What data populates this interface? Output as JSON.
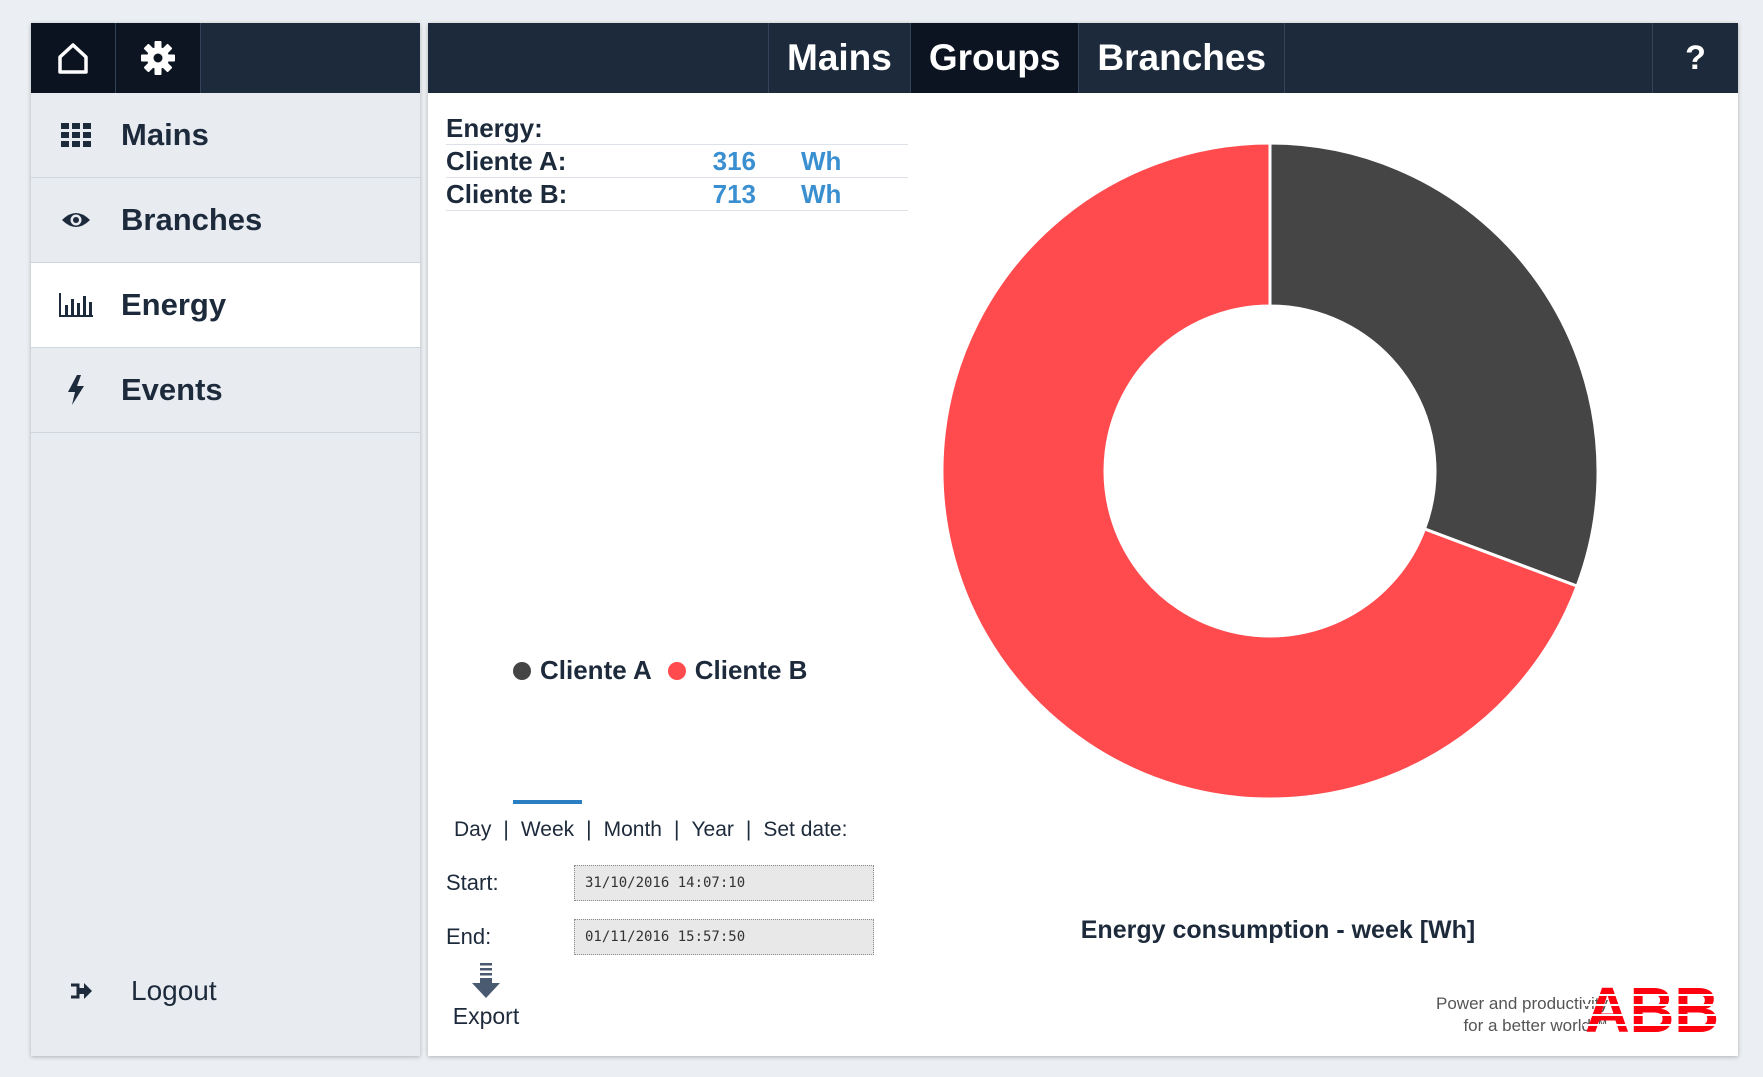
{
  "sidebar": {
    "items": [
      {
        "label": "Mains"
      },
      {
        "label": "Branches"
      },
      {
        "label": "Energy"
      },
      {
        "label": "Events"
      }
    ],
    "logout_label": "Logout"
  },
  "header": {
    "tabs": [
      {
        "label": "Mains"
      },
      {
        "label": "Groups"
      },
      {
        "label": "Branches"
      }
    ],
    "help_label": "?"
  },
  "energy": {
    "title": "Energy:",
    "rows": [
      {
        "label": "Cliente A:",
        "value": "316",
        "unit": "Wh"
      },
      {
        "label": "Cliente B:",
        "value": "713",
        "unit": "Wh"
      }
    ]
  },
  "legend": [
    {
      "label": "Cliente A",
      "color": "#454545"
    },
    {
      "label": "Cliente B",
      "color": "#ff4a4e"
    }
  ],
  "period": {
    "options": [
      "Day",
      "Week",
      "Month",
      "Year",
      "Set date:"
    ],
    "selected": "Week",
    "start_label": "Start:",
    "start_value": "31/10/2016 14:07:10",
    "end_label": "End:",
    "end_value": "01/11/2016 15:57:50",
    "export_label": "Export"
  },
  "chart_data": {
    "type": "pie",
    "title": "Energy consumption - week [Wh]",
    "categories": [
      "Cliente A",
      "Cliente B"
    ],
    "values": [
      316,
      713
    ],
    "colors": [
      "#454545",
      "#ff4a4e"
    ],
    "donut": true
  },
  "branding": {
    "tagline_line1": "Power and productivity",
    "tagline_line2": "for a better world™",
    "logo_text": "ABB",
    "logo_color": "#ff000f"
  },
  "colors": {
    "navy": "#1d2a3b",
    "accent_blue": "#3a8fd0"
  }
}
